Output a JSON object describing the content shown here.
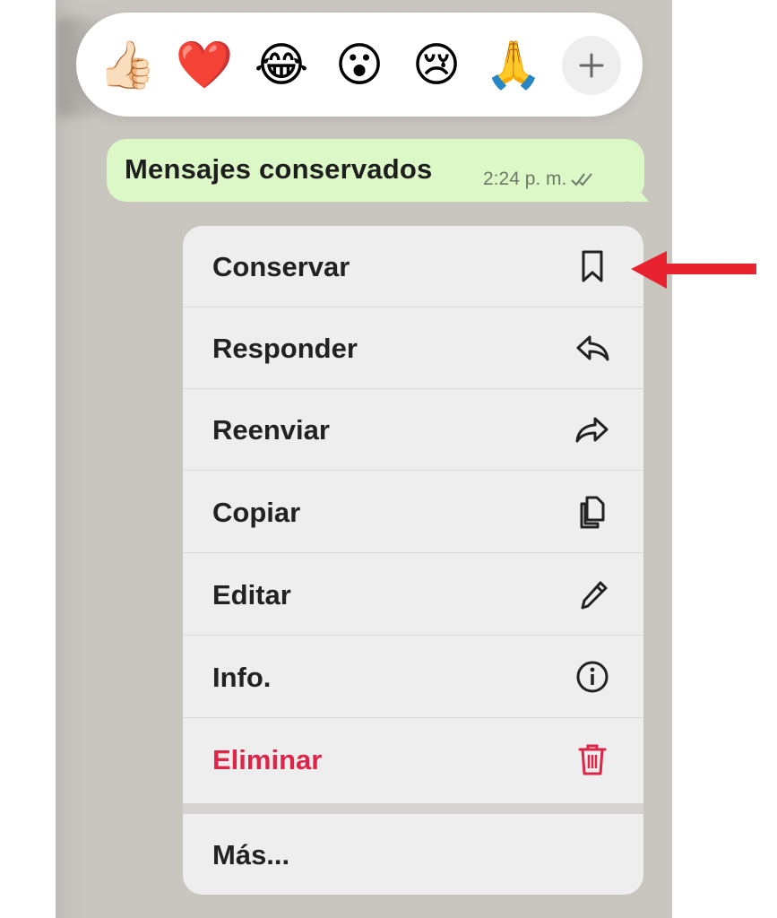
{
  "reactions": [
    {
      "name": "thumbs-up",
      "glyph": "👍🏻"
    },
    {
      "name": "heart",
      "glyph": "❤️"
    },
    {
      "name": "tears-of-joy",
      "glyph": "😂"
    },
    {
      "name": "surprised",
      "glyph": "😮"
    },
    {
      "name": "crying",
      "glyph": "😢"
    },
    {
      "name": "pray",
      "glyph": "🙏"
    }
  ],
  "reaction_more_icon": "plus-icon",
  "message": {
    "text": "Mensajes conservados",
    "time": "2:24 p. m.",
    "status_icon": "double-check-icon",
    "bubble_color": "#dcf8c6"
  },
  "menu": {
    "items": [
      {
        "label": "Conservar",
        "icon": "bookmark-icon"
      },
      {
        "label": "Responder",
        "icon": "reply-icon"
      },
      {
        "label": "Reenviar",
        "icon": "forward-icon"
      },
      {
        "label": "Copiar",
        "icon": "copy-icon"
      },
      {
        "label": "Editar",
        "icon": "pencil-icon"
      },
      {
        "label": "Info.",
        "icon": "info-icon"
      },
      {
        "label": "Eliminar",
        "icon": "trash-icon",
        "color": "#dc2548"
      }
    ],
    "more_label": "Más..."
  },
  "annotation": {
    "icon": "red-arrow-icon",
    "color": "#e8232f"
  }
}
